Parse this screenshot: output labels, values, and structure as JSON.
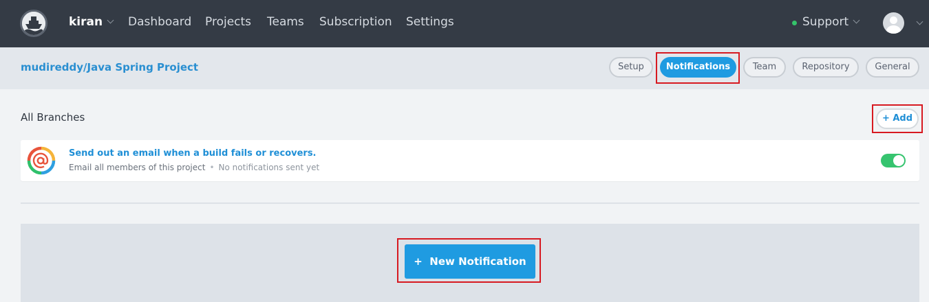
{
  "nav": {
    "user": "kiran",
    "links": [
      "Dashboard",
      "Projects",
      "Teams",
      "Subscription",
      "Settings"
    ],
    "support": "Support",
    "logo_icon": "ship-logo-icon",
    "avatar_icon": "user-avatar-icon"
  },
  "project": {
    "title": "mudireddy/Java Spring Project",
    "tabs": [
      "Setup",
      "Notifications",
      "Team",
      "Repository",
      "General"
    ],
    "active_tab": "Notifications"
  },
  "branches": {
    "title": "All Branches",
    "add_label": "+ Add"
  },
  "notification": {
    "title": "Send out an email when a build fails or recovers.",
    "recipients": "Email all members of this project",
    "separator": "•",
    "status": "No notifications sent yet",
    "enabled": true
  },
  "new_notification": {
    "label": "+  New Notification"
  },
  "colors": {
    "nav_bg": "#343b45",
    "accent": "#1f9be1",
    "toggle_on": "#36c46f",
    "highlight_box": "#d71920"
  }
}
